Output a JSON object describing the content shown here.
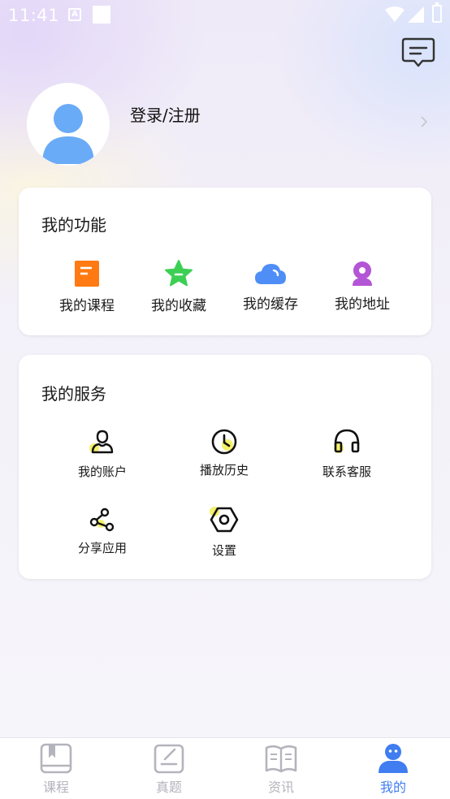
{
  "status_bar": {
    "time": "11:41",
    "indicator": "A"
  },
  "colors": {
    "accent": "#3f7df1",
    "orange": "#ff7a12",
    "green": "#3ccf54",
    "blue": "#4f8ef7",
    "purple": "#b455d6",
    "yellow": "#f4f06a",
    "inactive": "#b4b4bd"
  },
  "header": {
    "message_icon": "message-icon"
  },
  "profile": {
    "login_label": "登录/注册",
    "avatar_icon": "user-avatar-icon",
    "arrow_icon": "chevron-right-icon"
  },
  "functions": {
    "title": "我的功能",
    "items": [
      {
        "label": "我的课程",
        "icon": "course-book-icon"
      },
      {
        "label": "我的收藏",
        "icon": "star-icon"
      },
      {
        "label": "我的缓存",
        "icon": "cloud-icon"
      },
      {
        "label": "我的地址",
        "icon": "location-pin-icon"
      }
    ]
  },
  "services": {
    "title": "我的服务",
    "items": [
      {
        "label": "我的账户",
        "icon": "account-icon"
      },
      {
        "label": "播放历史",
        "icon": "clock-icon"
      },
      {
        "label": "联系客服",
        "icon": "headset-icon"
      },
      {
        "label": "分享应用",
        "icon": "share-icon"
      },
      {
        "label": "设置",
        "icon": "settings-hex-icon"
      }
    ]
  },
  "tabbar": {
    "tabs": [
      {
        "label": "课程",
        "icon": "course-tab-icon",
        "active": false
      },
      {
        "label": "真题",
        "icon": "exam-edit-icon",
        "active": false
      },
      {
        "label": "资讯",
        "icon": "news-book-icon",
        "active": false
      },
      {
        "label": "我的",
        "icon": "profile-tab-icon",
        "active": true
      }
    ]
  }
}
